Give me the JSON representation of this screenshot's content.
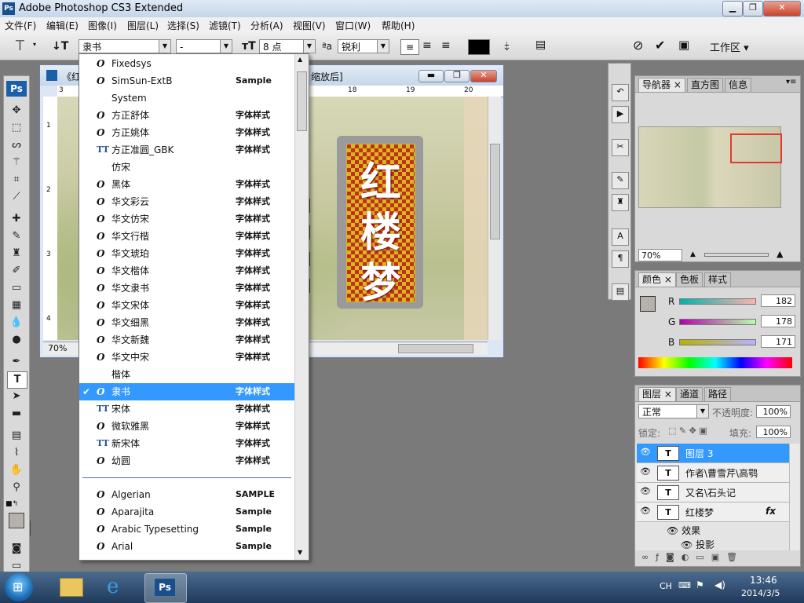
{
  "window": {
    "title": "Adobe Photoshop CS3 Extended",
    "app_icon": "Ps"
  },
  "menu": [
    "文件(F)",
    "编辑(E)",
    "图像(I)",
    "图层(L)",
    "选择(S)",
    "滤镜(T)",
    "分析(A)",
    "视图(V)",
    "窗口(W)",
    "帮助(H)"
  ],
  "options": {
    "font_family": "隶书",
    "font_style": "-",
    "font_size": "8 点",
    "aa_label": "ªa",
    "antialias": "锐利",
    "workspace": "工作区"
  },
  "document": {
    "title_left": "《红",
    "title_right": "缩放后]",
    "zoom": "70%",
    "ruler_top": [
      "3",
      "18",
      "19",
      "20"
    ],
    "ruler_left": [
      "1",
      "2",
      "3",
      "4"
    ],
    "banner_chars": [
      "红",
      "楼",
      "梦"
    ],
    "colors": {
      "banner_gold": "#d9b81e",
      "banner_red": "#c0301e"
    }
  },
  "font_list": {
    "items": [
      {
        "icon": "O",
        "name": "Fixedsys",
        "sample": ""
      },
      {
        "icon": "O",
        "name": "SimSun-ExtB",
        "sample": "Sample"
      },
      {
        "icon": "",
        "name": "System",
        "sample": ""
      },
      {
        "icon": "O",
        "name": "方正舒体",
        "sample": "字体样式"
      },
      {
        "icon": "O",
        "name": "方正姚体",
        "sample": "字体样式"
      },
      {
        "icon": "TT",
        "name": "方正准圆_GBK",
        "sample": "字体样式"
      },
      {
        "icon": "",
        "name": "仿宋",
        "sample": ""
      },
      {
        "icon": "O",
        "name": "黑体",
        "sample": "字体样式"
      },
      {
        "icon": "O",
        "name": "华文彩云",
        "sample": "字体样式"
      },
      {
        "icon": "O",
        "name": "华文仿宋",
        "sample": "字体样式"
      },
      {
        "icon": "O",
        "name": "华文行楷",
        "sample": "字体样式"
      },
      {
        "icon": "O",
        "name": "华文琥珀",
        "sample": "字体样式"
      },
      {
        "icon": "O",
        "name": "华文楷体",
        "sample": "字体样式"
      },
      {
        "icon": "O",
        "name": "华文隶书",
        "sample": "字体样式"
      },
      {
        "icon": "O",
        "name": "华文宋体",
        "sample": "字体样式"
      },
      {
        "icon": "O",
        "name": "华文细黑",
        "sample": "字体样式"
      },
      {
        "icon": "O",
        "name": "华文新魏",
        "sample": "字体样式"
      },
      {
        "icon": "O",
        "name": "华文中宋",
        "sample": "字体样式"
      },
      {
        "icon": "",
        "name": "楷体",
        "sample": ""
      },
      {
        "icon": "O",
        "name": "隶书",
        "sample": "字体样式",
        "selected": true
      },
      {
        "icon": "TT",
        "name": "宋体",
        "sample": "字体样式"
      },
      {
        "icon": "O",
        "name": "微软雅黑",
        "sample": "字体样式"
      },
      {
        "icon": "TT",
        "name": "新宋体",
        "sample": "字体样式"
      },
      {
        "icon": "O",
        "name": "幼圆",
        "sample": "字体样式"
      }
    ],
    "western": [
      {
        "icon": "O",
        "name": "Algerian",
        "sample": "SAMPLE"
      },
      {
        "icon": "O",
        "name": "Aparajita",
        "sample": "Sample"
      },
      {
        "icon": "O",
        "name": "Arabic Typesetting",
        "sample": "Sample"
      },
      {
        "icon": "O",
        "name": "Arial",
        "sample": "Sample"
      }
    ]
  },
  "navigator": {
    "tabs": [
      "导航器",
      "直方图",
      "信息"
    ],
    "zoom": "70%"
  },
  "color_panel": {
    "tabs": [
      "颜色",
      "色板",
      "样式"
    ],
    "r_label": "R",
    "g_label": "G",
    "b_label": "B",
    "r": "182",
    "g": "178",
    "b": "171",
    "fg_color": "#b6b2ab"
  },
  "layers_panel": {
    "tabs": [
      "图层",
      "通道",
      "路径"
    ],
    "blend_mode": "正常",
    "opacity_label": "不透明度:",
    "opacity": "100%",
    "lock_label": "锁定:",
    "fill_label": "填充:",
    "fill": "100%",
    "layers": [
      {
        "name": "图层 3",
        "selected": true
      },
      {
        "name": "作者\\曹雪芹\\高鹗"
      },
      {
        "name": "又名\\石头记"
      },
      {
        "name": "红楼梦",
        "fx": "fx"
      }
    ],
    "effects_label": "效果",
    "shadow_label": "投影"
  },
  "taskbar": {
    "lang": "CH",
    "time": "13:46",
    "date": "2014/3/5"
  }
}
